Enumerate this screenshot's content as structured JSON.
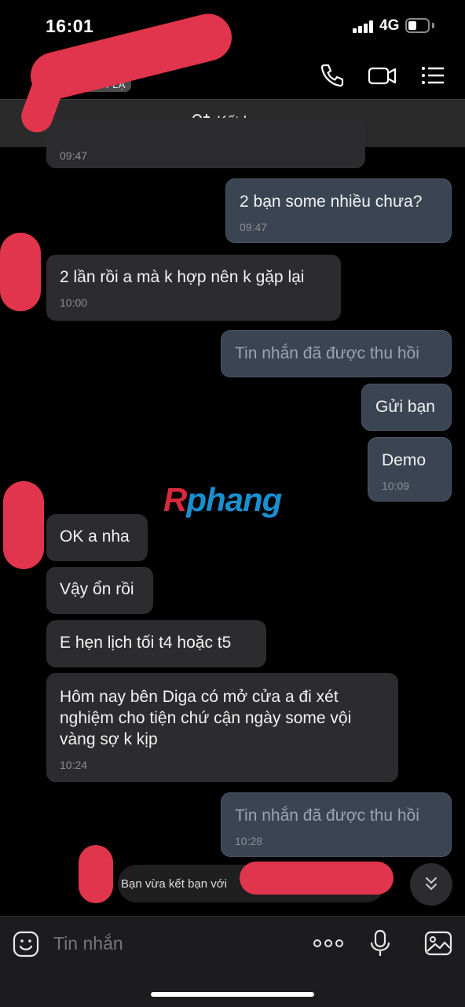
{
  "status": {
    "time": "16:01",
    "network": "4G"
  },
  "header": {
    "badge": "NGƯỜI LẠ",
    "friend_button": "Kết bạn"
  },
  "messages": [
    {
      "dir": "in",
      "text": "",
      "time": "09:47"
    },
    {
      "dir": "out",
      "text": "2 bạn some nhiều chưa?",
      "time": "09:47"
    },
    {
      "dir": "in",
      "text": "2 lần rồi a mà k hợp nên k gặp lại",
      "time": "10:00"
    },
    {
      "dir": "out",
      "text": "Tin nhắn đã được thu hồi",
      "recalled": true
    },
    {
      "dir": "out",
      "text": "Gửi bạn"
    },
    {
      "dir": "out",
      "text": "Demo",
      "time": "10:09"
    },
    {
      "dir": "in",
      "text": "OK a nha"
    },
    {
      "dir": "in",
      "text": "Vậy ổn rồi"
    },
    {
      "dir": "in",
      "text": "E hẹn lịch tối t4 hoặc t5"
    },
    {
      "dir": "in",
      "text": "Hôm nay bên Diga có mở cửa a đi xét nghiệm cho tiện chứ cận ngày some vội vàng sợ k kịp",
      "time": "10:24"
    },
    {
      "dir": "out",
      "text": "Tin nhắn đã được thu hồi",
      "time": "10:28",
      "recalled": true
    }
  ],
  "system_note": "Bạn vừa kết bạn với",
  "watermark": {
    "first": "R",
    "rest": "phang"
  },
  "composer": {
    "placeholder": "Tin nhắn"
  },
  "colors": {
    "background": "#000000",
    "bubble_in": "#2c2c2e",
    "bubble_out": "#3b4452",
    "redaction": "#e0354c",
    "watermark": "#1a8fd0"
  }
}
